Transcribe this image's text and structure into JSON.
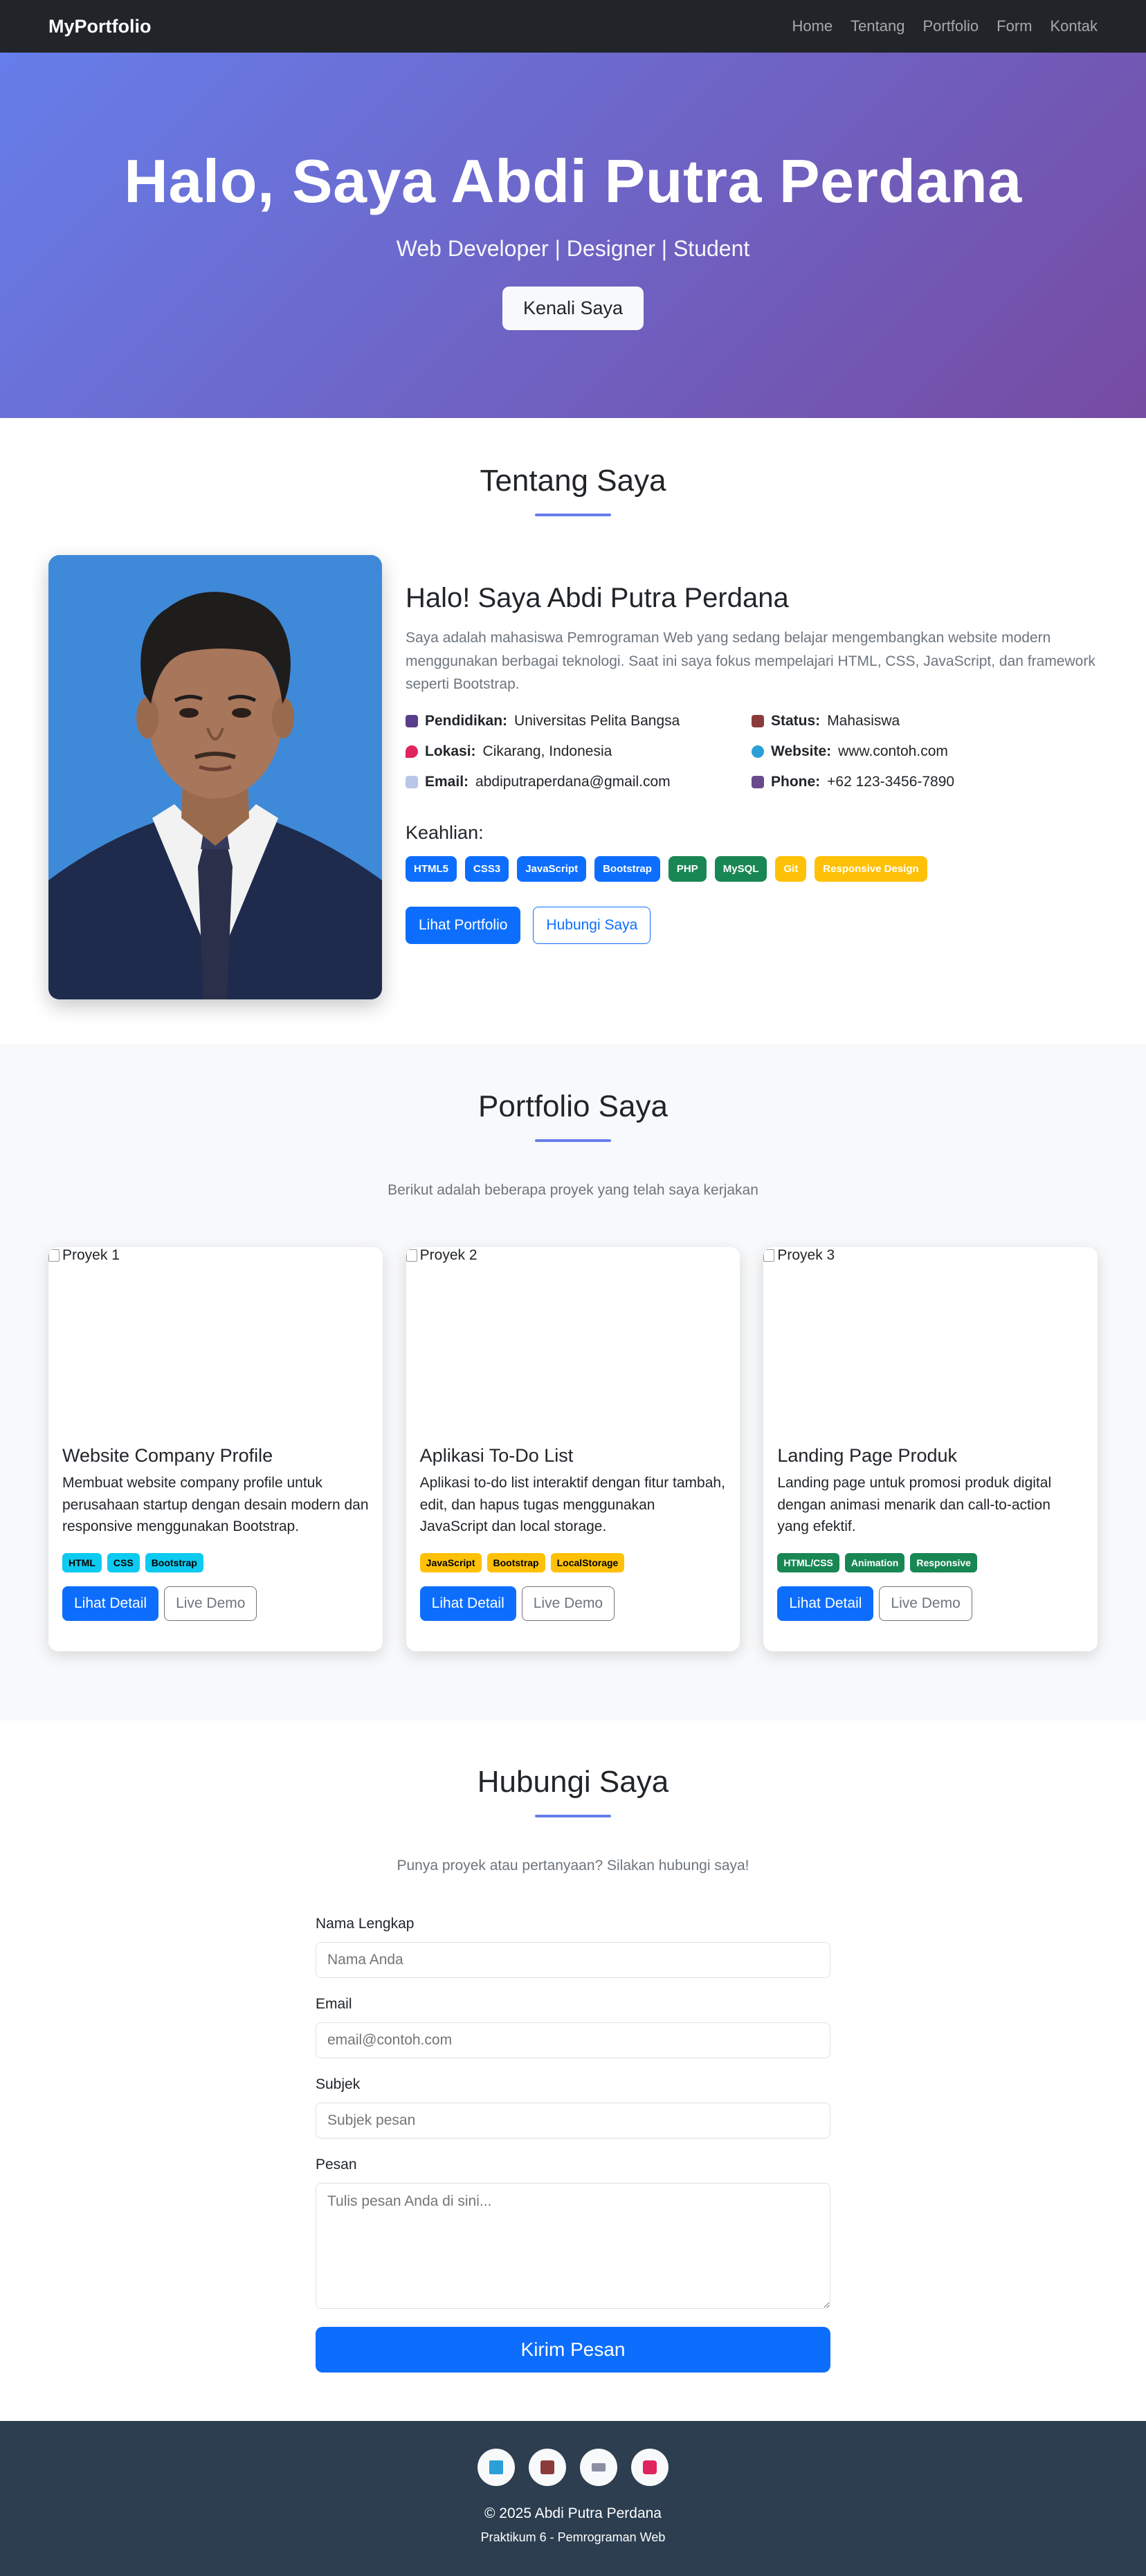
{
  "navbar": {
    "brand": "MyPortfolio",
    "links": [
      "Home",
      "Tentang",
      "Portfolio",
      "Form",
      "Kontak"
    ]
  },
  "hero": {
    "title": "Halo, Saya Abdi Putra Perdana",
    "subtitle": "Web Developer | Designer | Student",
    "button": "Kenali Saya"
  },
  "about": {
    "title": "Tentang Saya",
    "heading": "Halo! Saya Abdi Putra Perdana",
    "description": "Saya adalah mahasiswa Pemrograman Web yang sedang belajar mengembangkan website modern menggunakan berbagai teknologi. Saat ini saya fokus mempelajari HTML, CSS, JavaScript, dan framework seperti Bootstrap.",
    "info": [
      {
        "icon": "graduation-cap-icon",
        "label": "Pendidikan:",
        "value": "Universitas Pelita Bangsa"
      },
      {
        "icon": "briefcase-icon",
        "label": "Status:",
        "value": "Mahasiswa"
      },
      {
        "icon": "pin-icon",
        "label": "Lokasi:",
        "value": "Cikarang, Indonesia"
      },
      {
        "icon": "globe-icon",
        "label": "Website:",
        "value": "www.contoh.com"
      },
      {
        "icon": "email-icon",
        "label": "Email:",
        "value": "abdiputraperdana@gmail.com"
      },
      {
        "icon": "phone-icon",
        "label": "Phone:",
        "value": "+62 123-3456-7890"
      }
    ],
    "skills_title": "Keahlian:",
    "skills": [
      "HTML5",
      "CSS3",
      "JavaScript",
      "Bootstrap",
      "PHP",
      "MySQL",
      "Git",
      "Responsive Design"
    ],
    "btn_portfolio": "Lihat Portfolio",
    "btn_contact": "Hubungi Saya"
  },
  "portfolio": {
    "title": "Portfolio Saya",
    "subtitle": "Berikut adalah beberapa proyek yang telah saya kerjakan",
    "cards": [
      {
        "alt": "Proyek 1",
        "title": "Website Company Profile",
        "desc": "Membuat website company profile untuk perusahaan startup dengan desain modern dan responsive menggunakan Bootstrap.",
        "tags": [
          "HTML",
          "CSS",
          "Bootstrap"
        ],
        "detail": "Lihat Detail",
        "demo": "Live Demo"
      },
      {
        "alt": "Proyek 2",
        "title": "Aplikasi To-Do List",
        "desc": "Aplikasi to-do list interaktif dengan fitur tambah, edit, dan hapus tugas menggunakan JavaScript dan local storage.",
        "tags": [
          "JavaScript",
          "Bootstrap",
          "LocalStorage"
        ],
        "detail": "Lihat Detail",
        "demo": "Live Demo"
      },
      {
        "alt": "Proyek 3",
        "title": "Landing Page Produk",
        "desc": "Landing page untuk promosi produk digital dengan animasi menarik dan call-to-action yang efektif.",
        "tags": [
          "HTML/CSS",
          "Animation",
          "Responsive"
        ],
        "detail": "Lihat Detail",
        "demo": "Live Demo"
      }
    ]
  },
  "contact": {
    "title": "Hubungi Saya",
    "subtitle": "Punya proyek atau pertanyaan? Silakan hubungi saya!",
    "name_label": "Nama Lengkap",
    "name_placeholder": "Nama Anda",
    "email_label": "Email",
    "email_placeholder": "email@contoh.com",
    "subject_label": "Subjek",
    "subject_placeholder": "Subjek pesan",
    "message_label": "Pesan",
    "message_placeholder": "Tulis pesan Anda di sini...",
    "submit": "Kirim Pesan"
  },
  "footer": {
    "socials": [
      "book-icon",
      "briefcase-icon",
      "keyboard-icon",
      "camera-icon"
    ],
    "copyright": "© 2025 Abdi Putra Perdana",
    "course": "Praktikum 6 - Pemrograman Web"
  },
  "colors": {
    "hero_start": "#667eea",
    "hero_end": "#764ba2",
    "primary": "#0d6efd",
    "success": "#198754",
    "warning": "#ffc107",
    "info": "#0dcaf0",
    "footer": "#2c3e50"
  }
}
